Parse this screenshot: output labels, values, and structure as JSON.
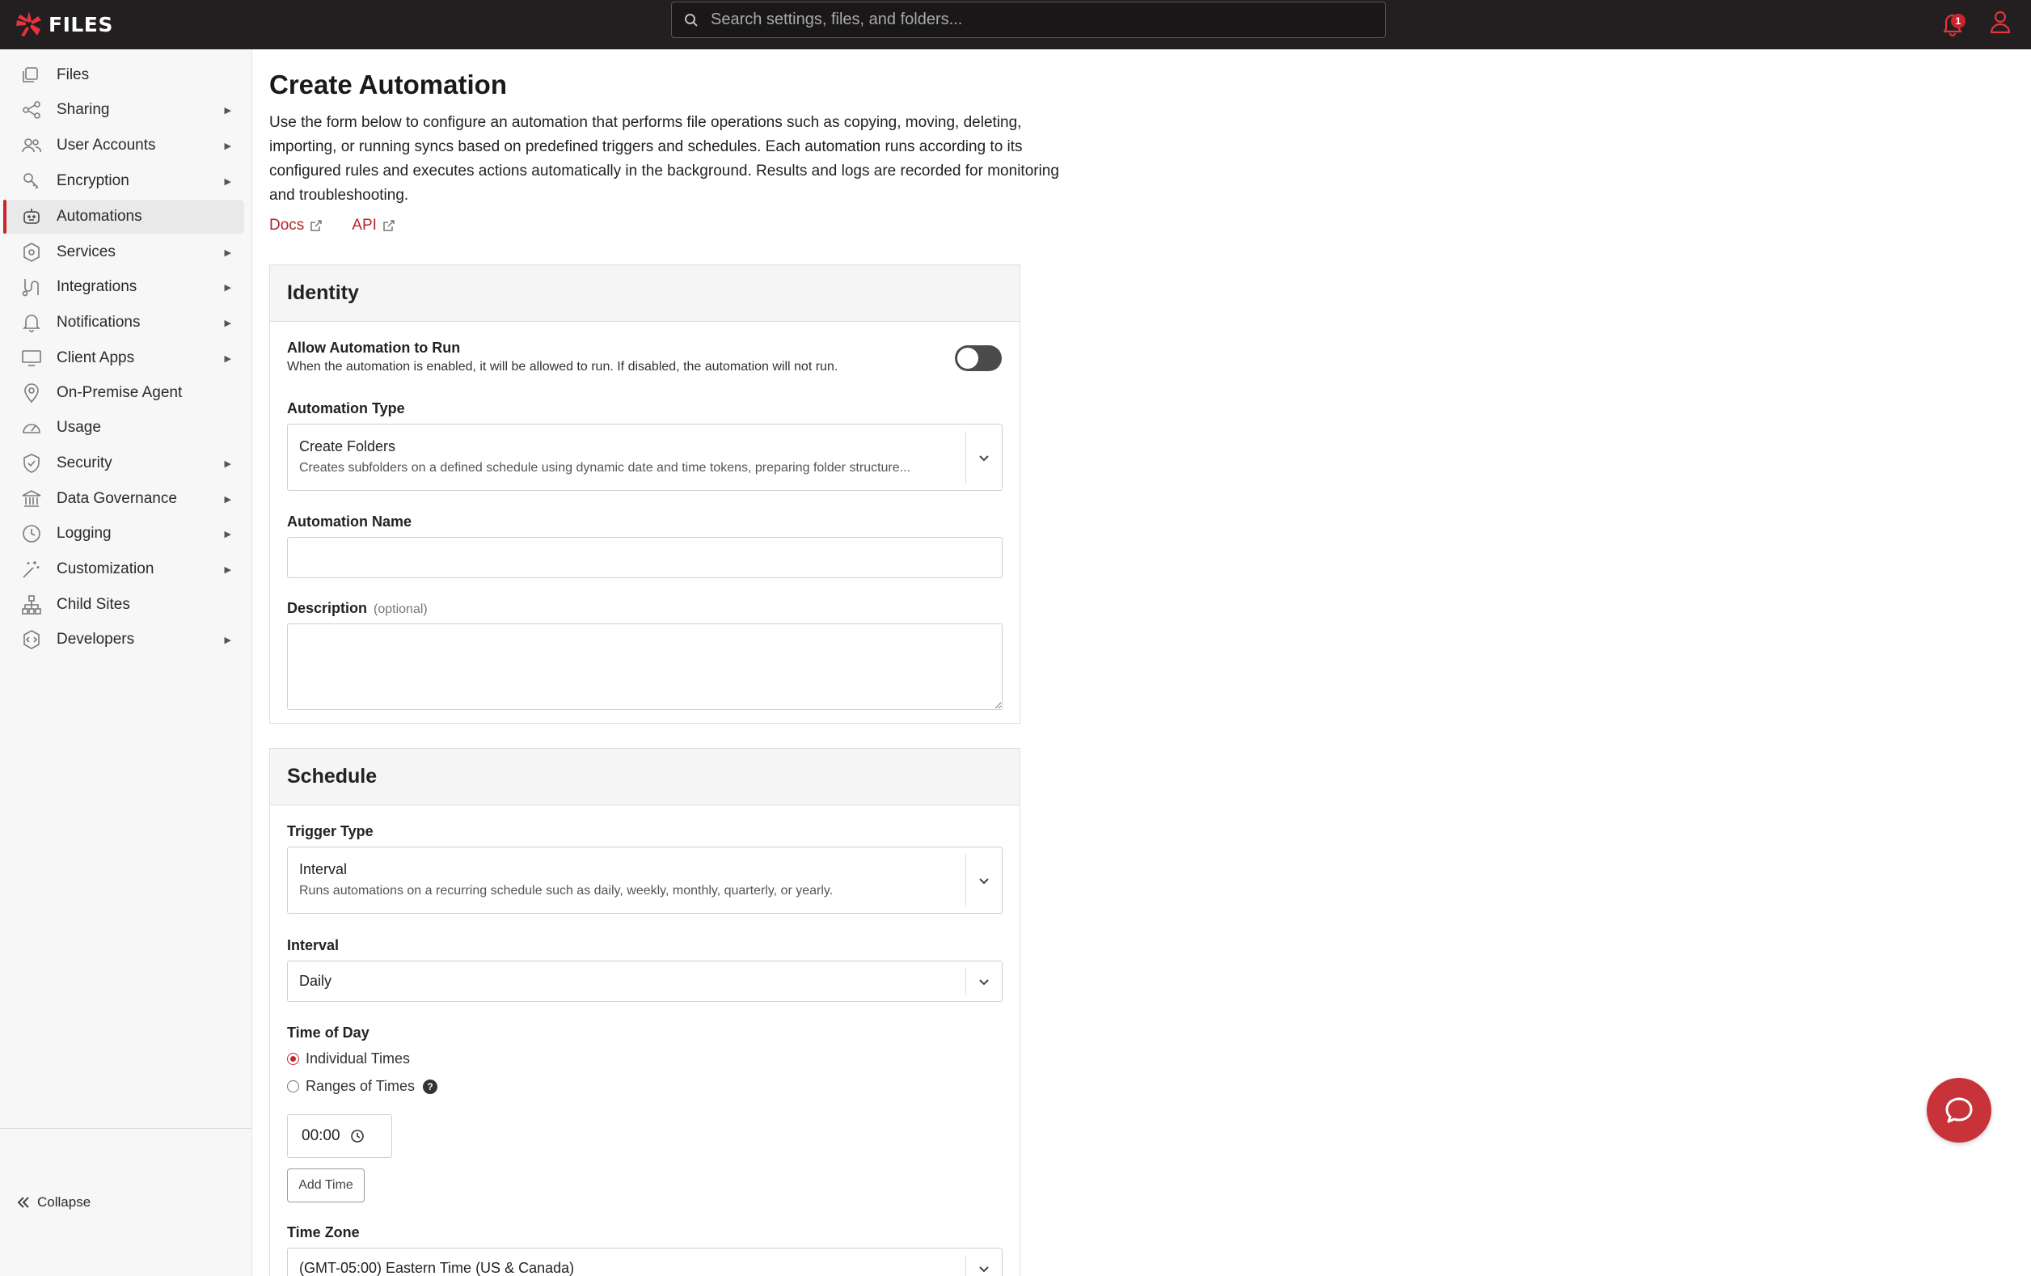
{
  "header": {
    "logo_text": "FILES",
    "search_placeholder": "Search settings, files, and folders...",
    "notification_count": "1"
  },
  "sidebar": {
    "items": [
      {
        "label": "Files",
        "icon": "files-icon",
        "has_arrow": false
      },
      {
        "label": "Sharing",
        "icon": "share-icon",
        "has_arrow": true
      },
      {
        "label": "User Accounts",
        "icon": "users-icon",
        "has_arrow": true
      },
      {
        "label": "Encryption",
        "icon": "key-icon",
        "has_arrow": true
      },
      {
        "label": "Automations",
        "icon": "robot-icon",
        "has_arrow": false,
        "active": true
      },
      {
        "label": "Services",
        "icon": "services-icon",
        "has_arrow": true
      },
      {
        "label": "Integrations",
        "icon": "integrations-icon",
        "has_arrow": true
      },
      {
        "label": "Notifications",
        "icon": "bell-icon",
        "has_arrow": true
      },
      {
        "label": "Client Apps",
        "icon": "monitor-icon",
        "has_arrow": true
      },
      {
        "label": "On-Premise Agent",
        "icon": "location-icon",
        "has_arrow": false
      },
      {
        "label": "Usage",
        "icon": "gauge-icon",
        "has_arrow": false
      },
      {
        "label": "Security",
        "icon": "shield-icon",
        "has_arrow": true
      },
      {
        "label": "Data Governance",
        "icon": "bank-icon",
        "has_arrow": true
      },
      {
        "label": "Logging",
        "icon": "history-icon",
        "has_arrow": true
      },
      {
        "label": "Customization",
        "icon": "wand-icon",
        "has_arrow": true
      },
      {
        "label": "Child Sites",
        "icon": "sitemap-icon",
        "has_arrow": false
      },
      {
        "label": "Developers",
        "icon": "code-icon",
        "has_arrow": true
      }
    ],
    "collapse_label": "Collapse"
  },
  "main": {
    "title": "Create Automation",
    "description": "Use the form below to configure an automation that performs file operations such as copying, moving, deleting, importing, or running syncs based on predefined triggers and schedules. Each automation runs according to its configured rules and executes actions automatically in the background. Results and logs are recorded for monitoring and troubleshooting.",
    "docs_link": "Docs",
    "api_link": "API"
  },
  "identity": {
    "heading": "Identity",
    "allow_label": "Allow Automation to Run",
    "allow_help": "When the automation is enabled, it will be allowed to run. If disabled, the automation will not run.",
    "allow_enabled": false,
    "type_label": "Automation Type",
    "type_value": "Create Folders",
    "type_desc": "Creates subfolders on a defined schedule using dynamic date and time tokens, preparing folder structure...",
    "name_label": "Automation Name",
    "name_value": "",
    "description_label": "Description",
    "description_optional": "(optional)",
    "description_value": ""
  },
  "schedule": {
    "heading": "Schedule",
    "trigger_label": "Trigger Type",
    "trigger_value": "Interval",
    "trigger_desc": "Runs automations on a recurring schedule such as daily, weekly, monthly, quarterly, or yearly.",
    "interval_label": "Interval",
    "interval_value": "Daily",
    "time_of_day_label": "Time of Day",
    "radio_individual": "Individual Times",
    "radio_ranges": "Ranges of Times",
    "selected_radio": "Individual Times",
    "time_value": "00:00",
    "add_time_label": "Add Time",
    "timezone_label": "Time Zone",
    "timezone_value": "(GMT-05:00) Eastern Time (US & Canada)"
  },
  "colors": {
    "accent": "#c8262f",
    "topbar": "#231f20",
    "sidebar_bg": "#f7f7f7"
  }
}
